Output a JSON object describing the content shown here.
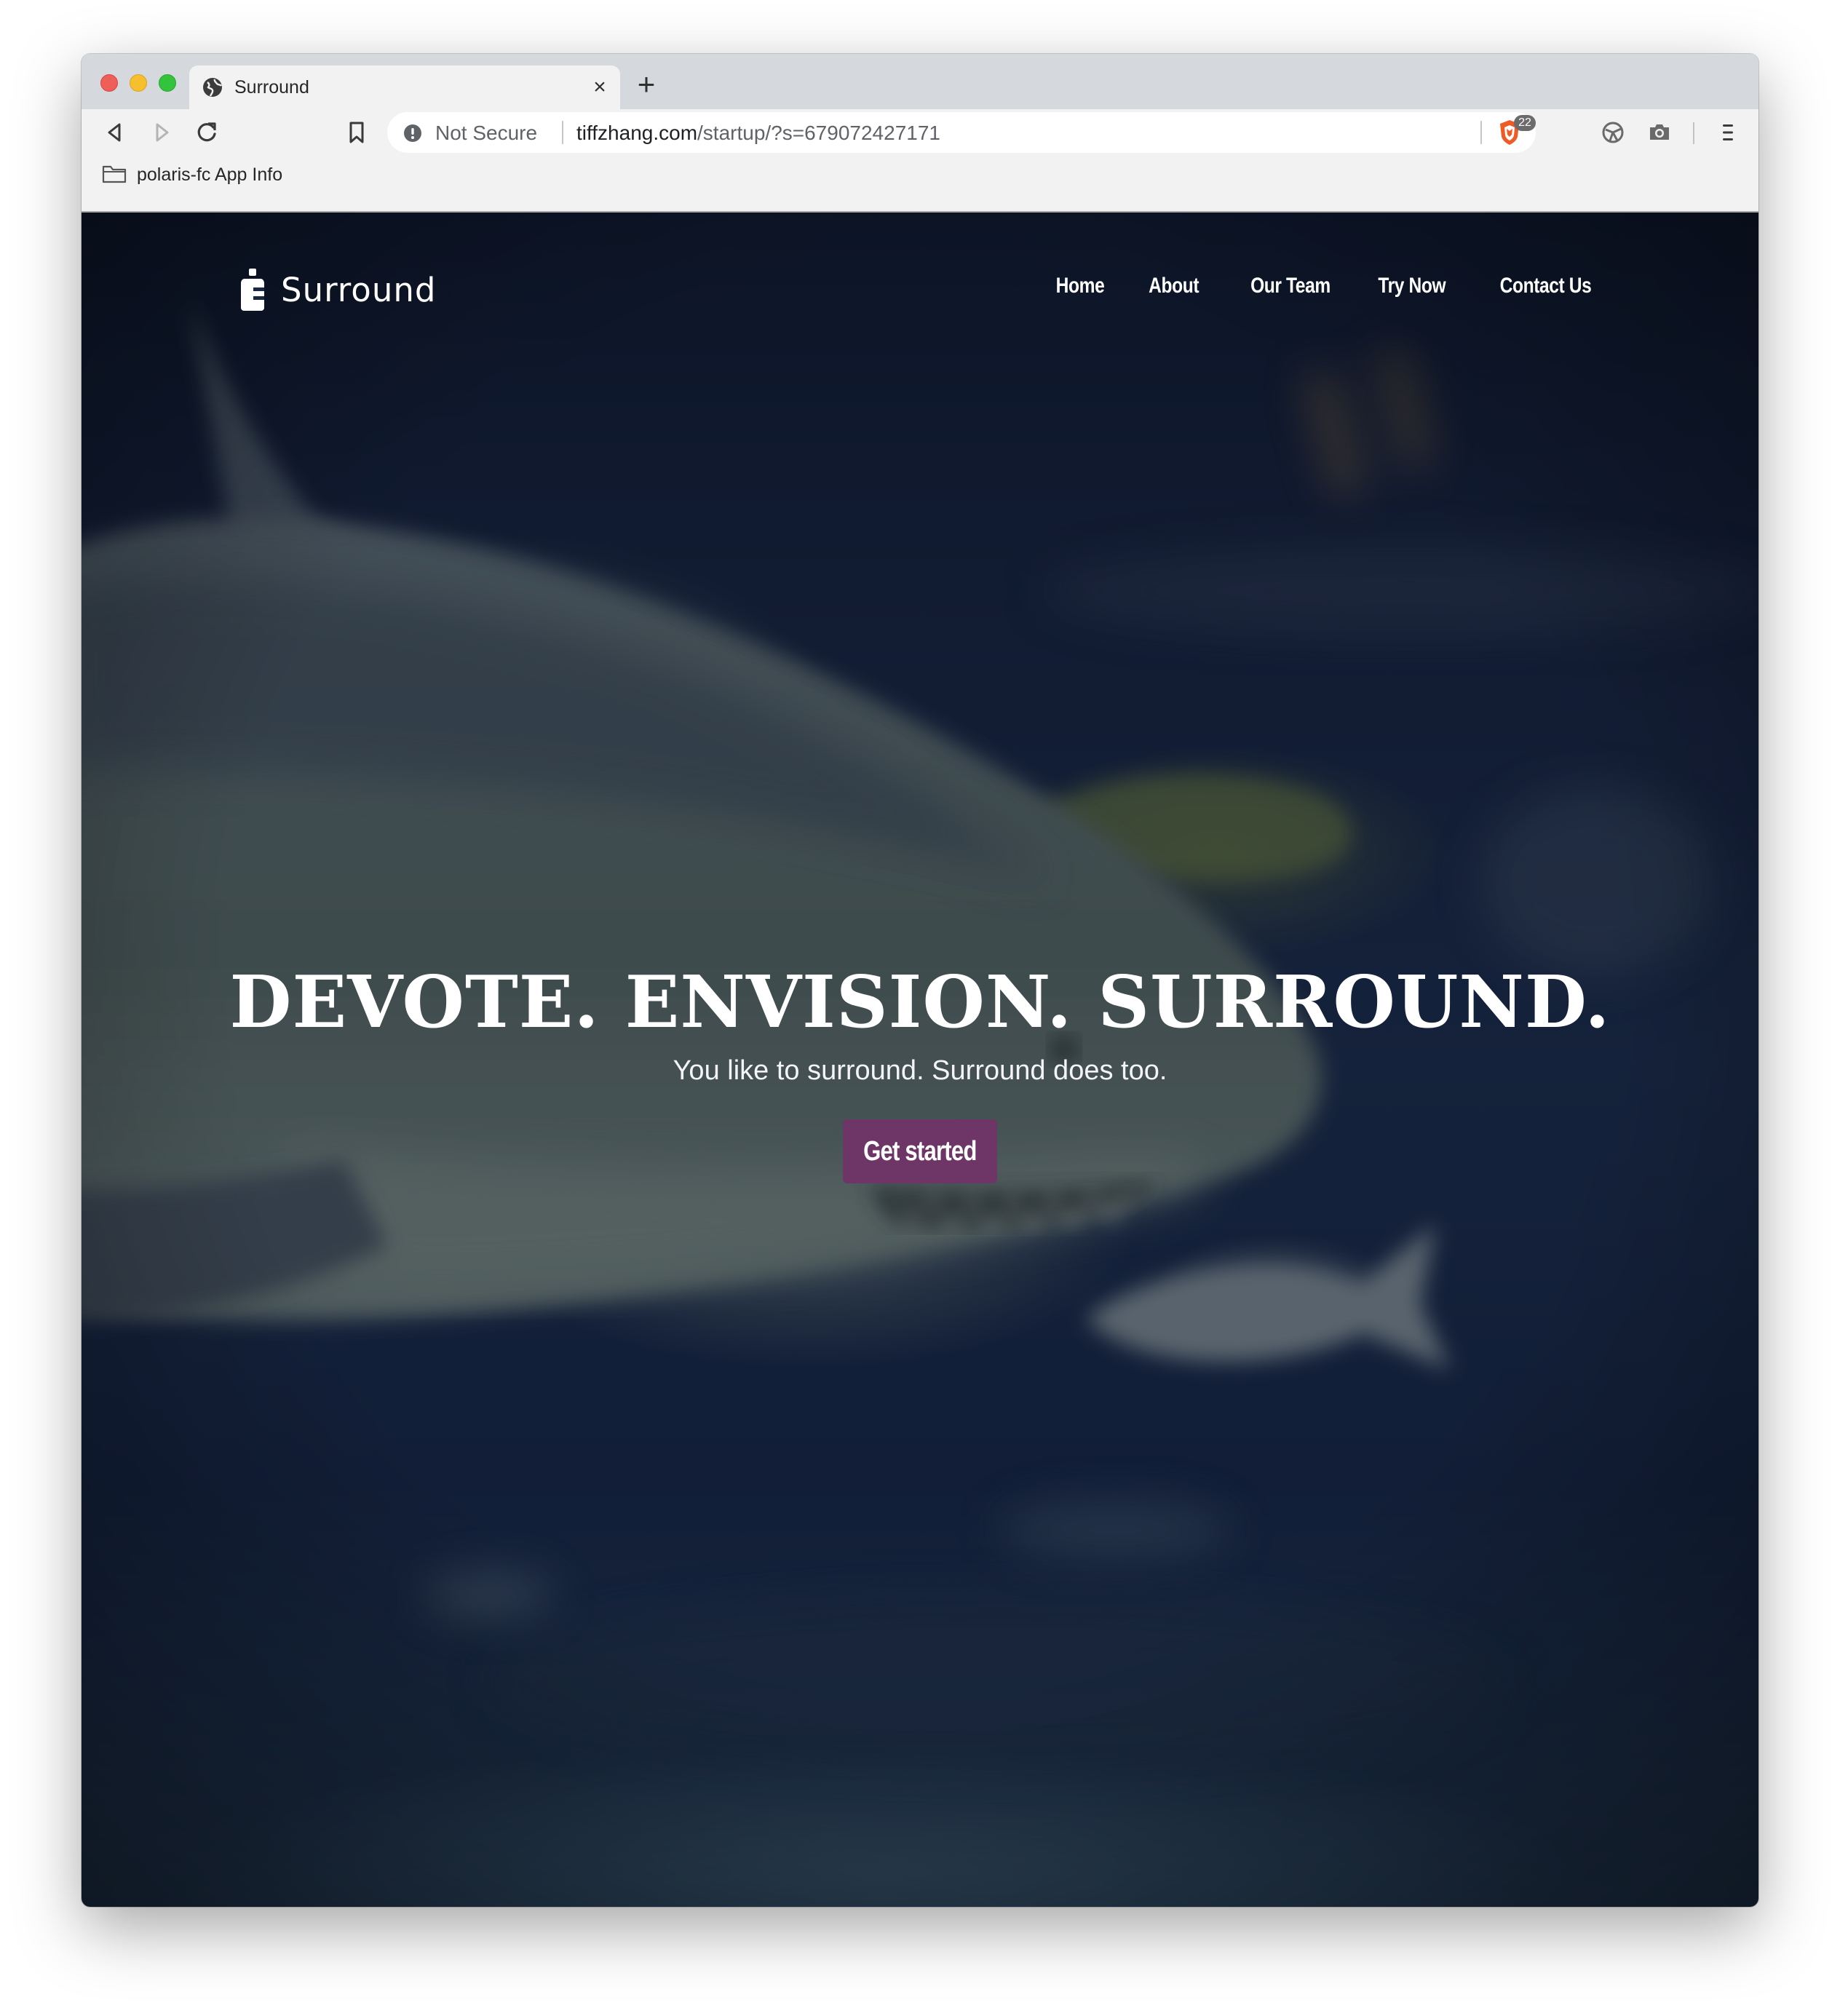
{
  "browser": {
    "tab": {
      "title": "Surround",
      "favicon": "globe-icon",
      "close_label": "×"
    },
    "new_tab_label": "+",
    "toolbar": {
      "back_icon": "back-arrow-icon",
      "forward_icon": "forward-arrow-icon",
      "reload_icon": "reload-icon",
      "bookmark_icon": "bookmark-icon",
      "menu_icon": "hamburger-menu-icon"
    },
    "omnibox": {
      "security_label": "Not Secure",
      "url_host": "tiffzhang.com",
      "url_path": "/startup/?s=679072427171",
      "shield_badge": "22"
    },
    "extensions": [
      "rewards-icon",
      "camera-icon"
    ],
    "bookmarks": [
      {
        "label": "polaris-fc App Info",
        "icon": "folder-icon"
      }
    ]
  },
  "site": {
    "brand": "Surround",
    "nav": [
      "Home",
      "About",
      "Our Team",
      "Try Now",
      "Contact Us"
    ],
    "hero": {
      "headline": "DEVOTE. ENVISION. SURROUND.",
      "subline": "You like to surround. Surround does too.",
      "cta_label": "Get started"
    }
  },
  "colors": {
    "cta": "#6e3567",
    "hero_overlay": "#15213a",
    "tab_strip": "#d5d8dc",
    "toolbar": "#f2f2f2",
    "brave_shield": "#f05a24",
    "traffic_close": "#ed5f58",
    "traffic_min": "#f6bf2e",
    "traffic_max": "#34c33c"
  }
}
